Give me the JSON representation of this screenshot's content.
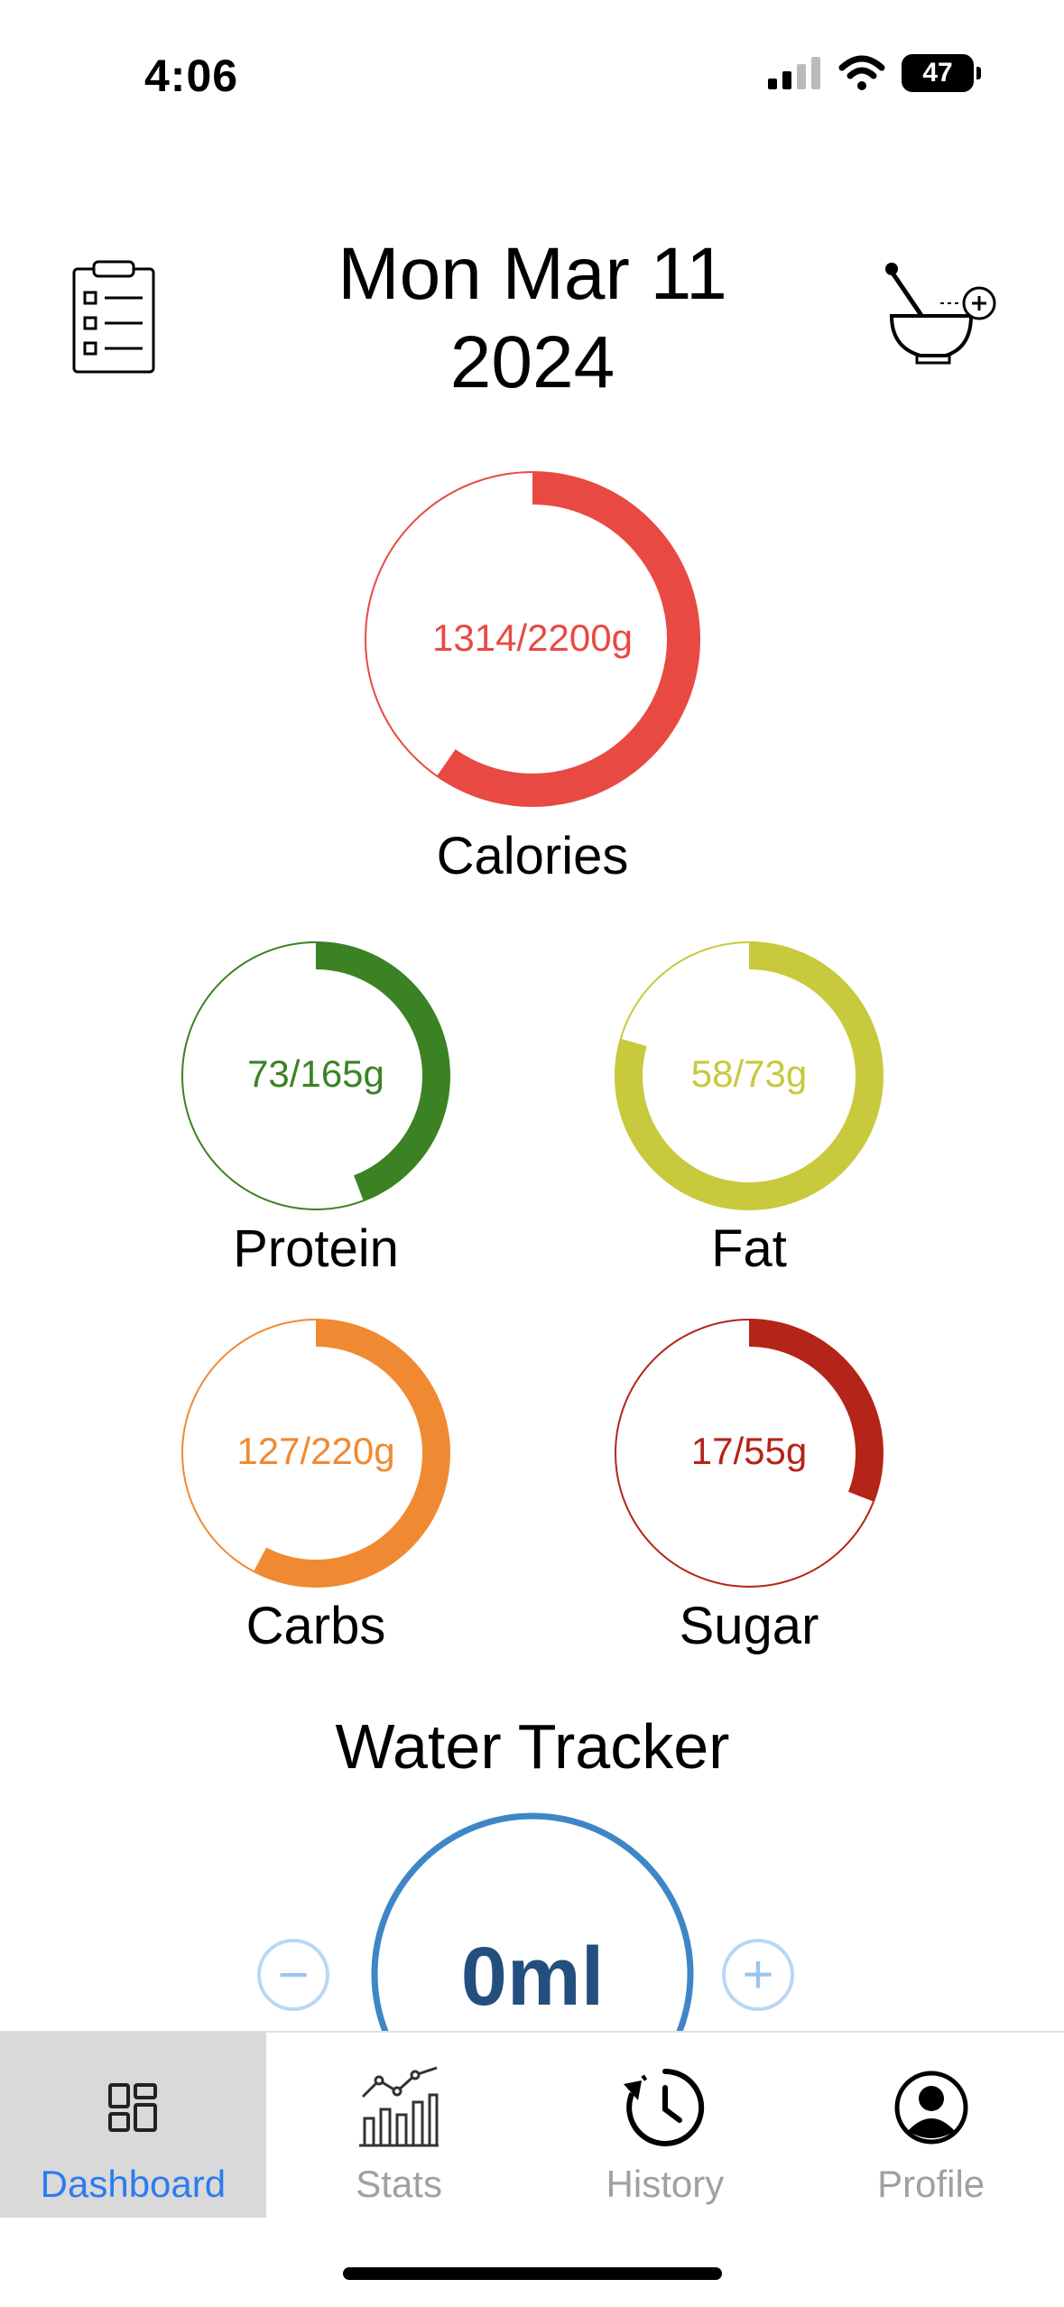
{
  "status_bar": {
    "time": "4:06",
    "battery": "47"
  },
  "header": {
    "date_line1": "Mon Mar 11",
    "date_line2": "2024"
  },
  "rings": {
    "calories": {
      "value_text": "1314/2200g",
      "label": "Calories",
      "fraction": 0.597,
      "color": "#e84a43"
    },
    "protein": {
      "value_text": "73/165g",
      "label": "Protein",
      "fraction": 0.442,
      "color": "#3b8224"
    },
    "fat": {
      "value_text": "58/73g",
      "label": "Fat",
      "fraction": 0.795,
      "color": "#c8c93c"
    },
    "carbs": {
      "value_text": "127/220g",
      "label": "Carbs",
      "fraction": 0.577,
      "color": "#f08a32"
    },
    "sugar": {
      "value_text": "17/55g",
      "label": "Sugar",
      "fraction": 0.309,
      "color": "#b42418"
    }
  },
  "water": {
    "title": "Water Tracker",
    "amount": "0ml",
    "minus": "−",
    "plus": "+",
    "color": "#3e86c7",
    "text_color": "#234f7e"
  },
  "tabs": [
    {
      "label": "Dashboard",
      "icon": "dashboard-icon",
      "active": true
    },
    {
      "label": "Stats",
      "icon": "stats-icon",
      "active": false
    },
    {
      "label": "History",
      "icon": "history-icon",
      "active": false
    },
    {
      "label": "Profile",
      "icon": "profile-icon",
      "active": false
    }
  ],
  "colors": {
    "accent": "#2d7bf0",
    "inactive_tab": "#a0a0a0"
  }
}
